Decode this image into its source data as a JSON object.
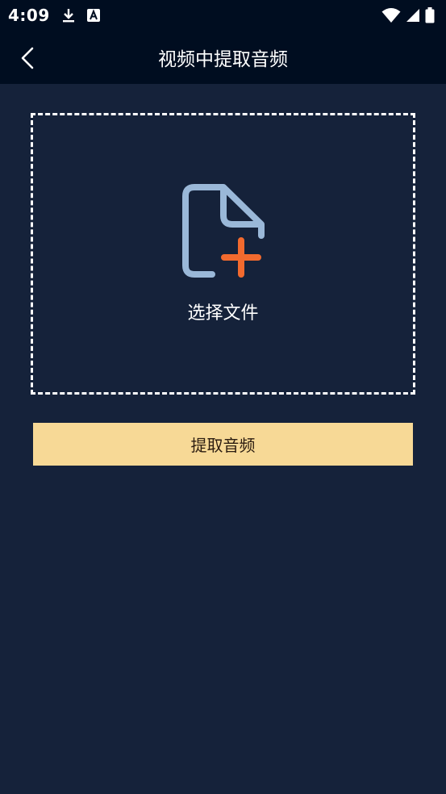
{
  "status_bar": {
    "time": "4:09",
    "icons": [
      "download-icon",
      "a-badge-icon",
      "wifi-icon",
      "signal-icon",
      "battery-icon"
    ]
  },
  "header": {
    "title": "视频中提取音频",
    "back_icon": "chevron-left-icon"
  },
  "upload": {
    "label": "选择文件",
    "icon": "file-add-icon",
    "icon_colors": {
      "file": "#9ab8d8",
      "plus": "#f26a2e"
    }
  },
  "actions": {
    "extract_label": "提取音频"
  },
  "colors": {
    "background": "#15223a",
    "bar": "#000d20",
    "accent_button": "#f7d996"
  }
}
